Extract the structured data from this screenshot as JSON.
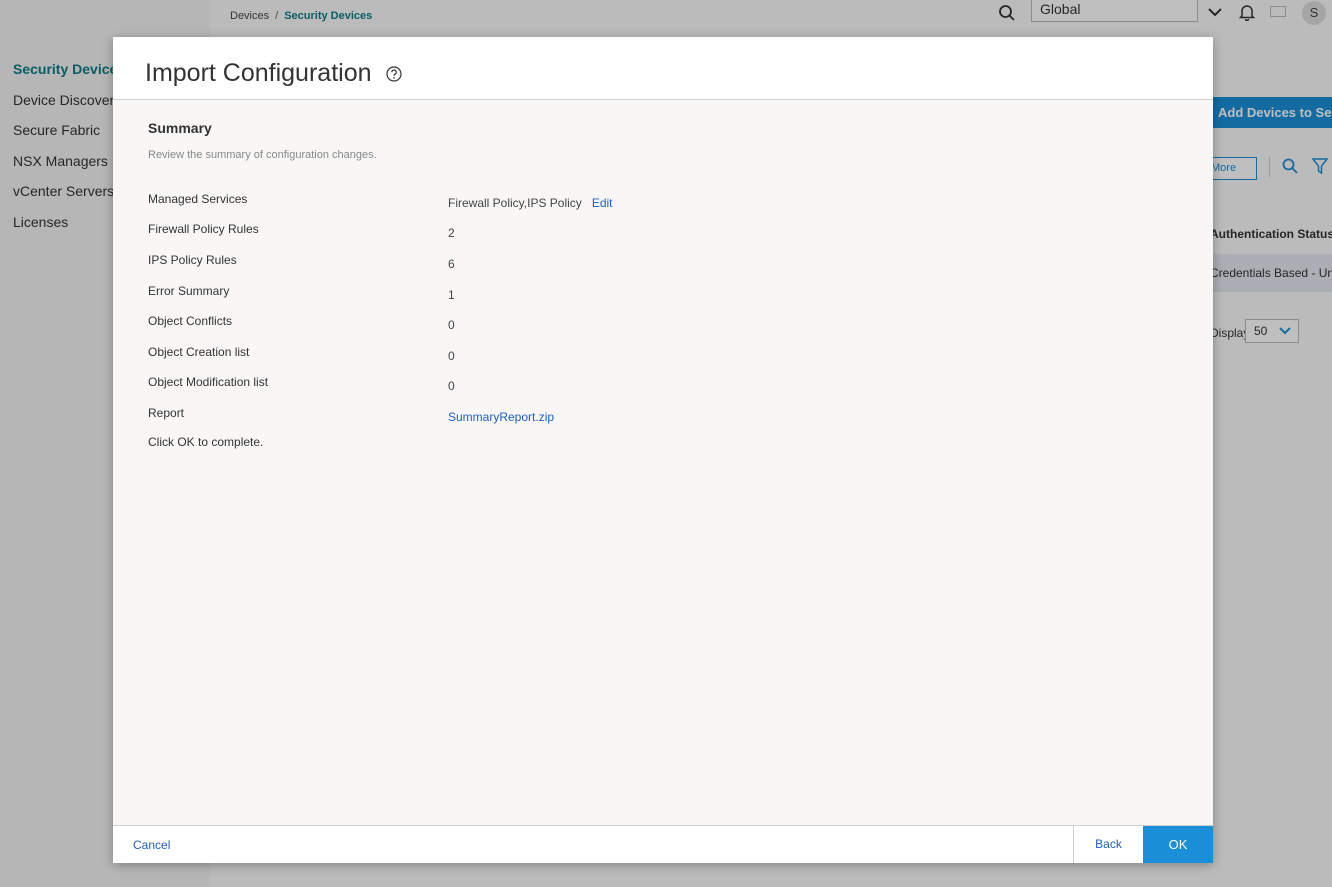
{
  "sidebar": {
    "items": [
      {
        "label": "Security Devices"
      },
      {
        "label": "Device Discovery"
      },
      {
        "label": "Secure Fabric"
      },
      {
        "label": "NSX Managers"
      },
      {
        "label": "vCenter Servers"
      },
      {
        "label": "Licenses"
      }
    ]
  },
  "breadcrumb": {
    "parent": "Devices",
    "separator": "/",
    "current": "Security Devices"
  },
  "topbar": {
    "scope_value": "Global",
    "avatar_initial": "S"
  },
  "background_page": {
    "primary_button": "Add Devices to Security Director",
    "more_button": "More",
    "column_header": "Authentication Status",
    "row_value": "Credentials Based - Unverified",
    "pager_label": "Display",
    "pager_value": "50"
  },
  "modal": {
    "title": "Import Configuration",
    "section_title": "Summary",
    "section_desc": "Review the summary of configuration changes.",
    "rows": [
      {
        "label": "Managed Services",
        "value": "Firewall Policy,IPS Policy",
        "action": "Edit"
      },
      {
        "label": "Firewall Policy Rules",
        "value": "2"
      },
      {
        "label": "IPS Policy Rules",
        "value": "6"
      },
      {
        "label": "Error Summary",
        "value": "1"
      },
      {
        "label": "Object Conflicts",
        "value": "0"
      },
      {
        "label": "Object Creation list",
        "value": "0"
      },
      {
        "label": "Object Modification list",
        "value": "0"
      },
      {
        "label": "Report",
        "value": "SummaryReport.zip"
      }
    ],
    "footer_note": "Click OK to complete.",
    "buttons": {
      "cancel": "Cancel",
      "back": "Back",
      "ok": "OK"
    }
  },
  "colors": {
    "accent": "#1a8fd8",
    "teal": "#0e7c86",
    "link": "#1f5fbf"
  }
}
